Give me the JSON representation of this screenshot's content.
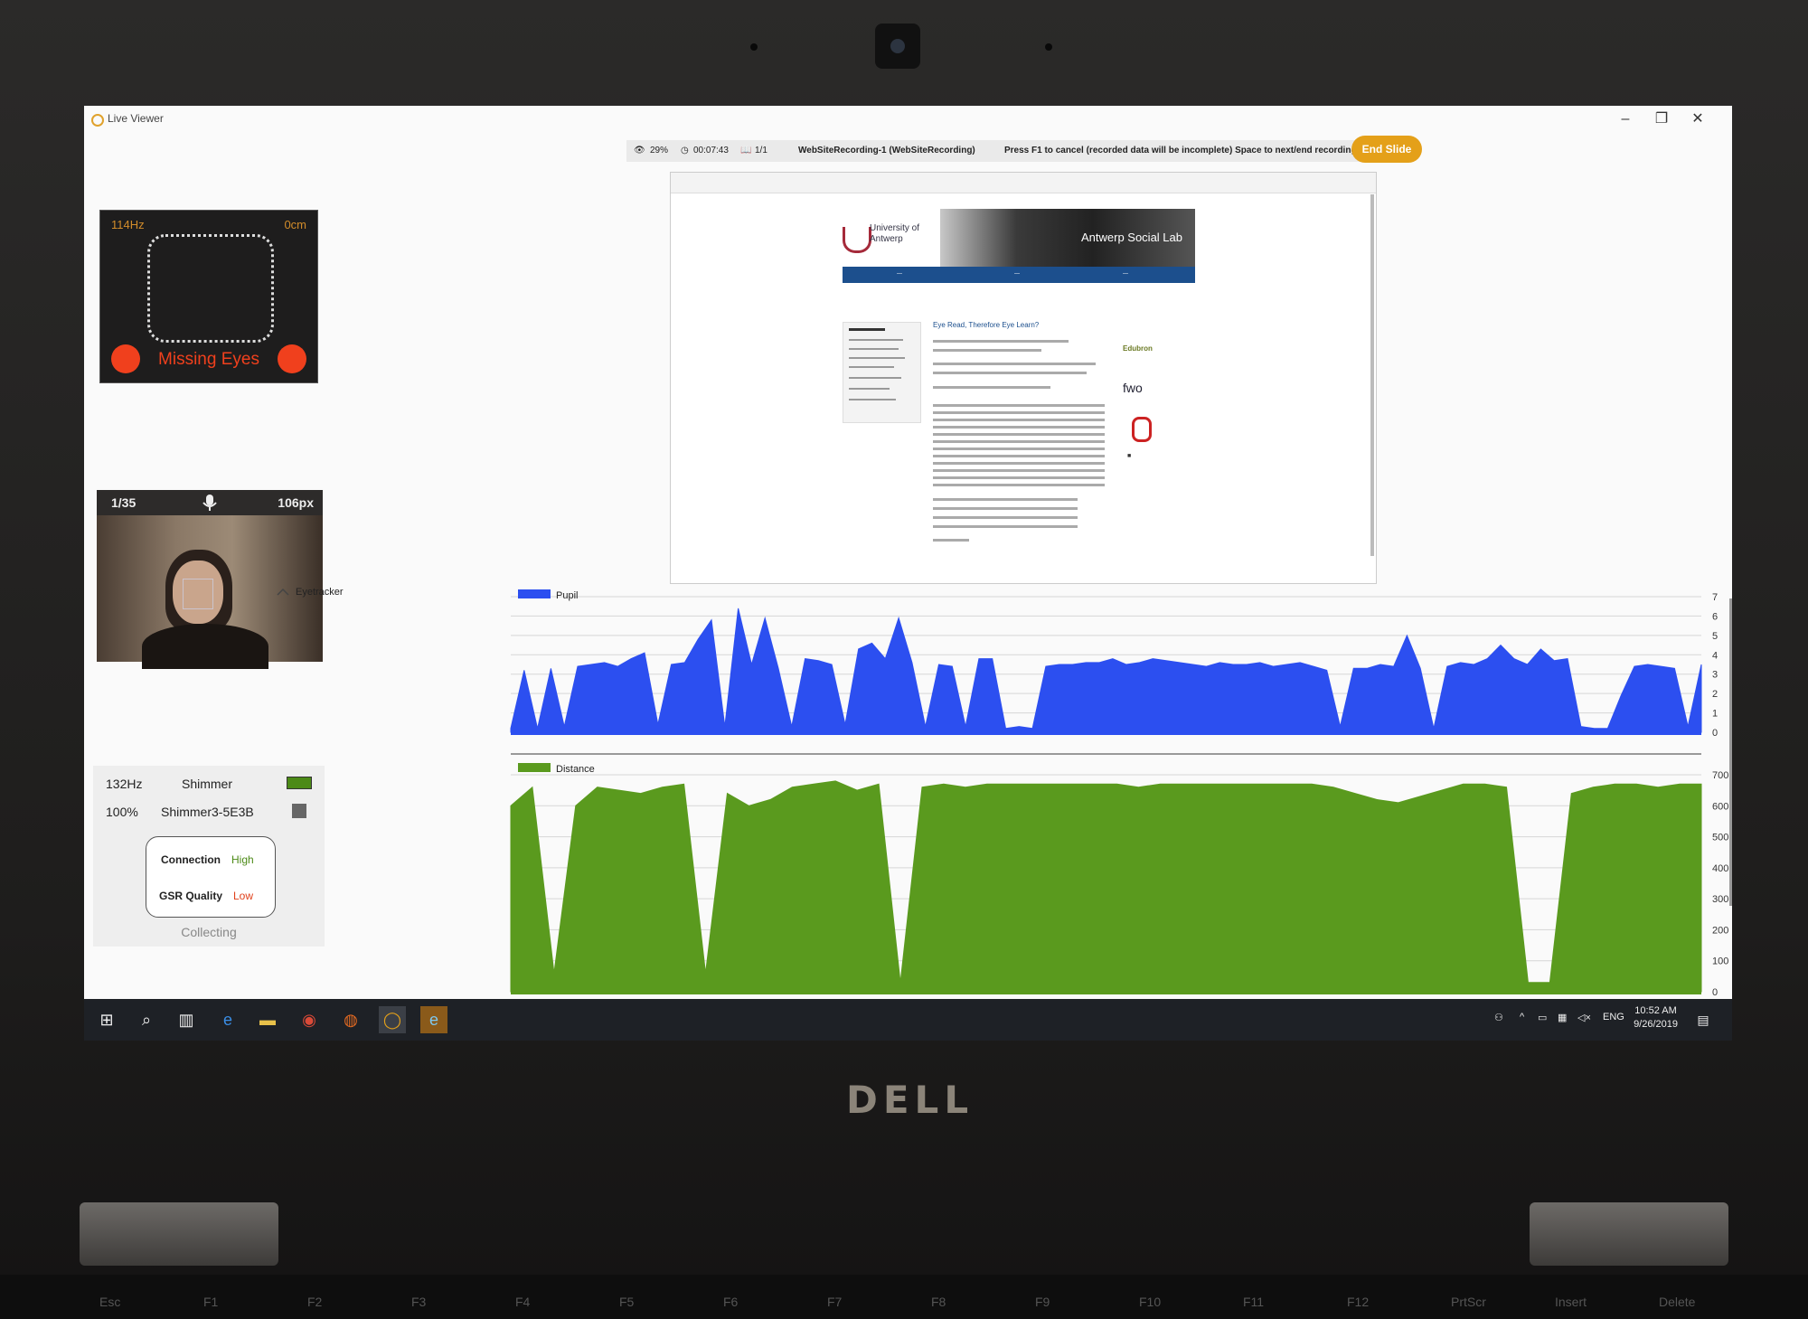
{
  "window": {
    "title": "Live Viewer"
  },
  "status": {
    "eye_percent": "29%",
    "timer": "00:07:43",
    "slide_count": "1/1",
    "recording": "WebSiteRecording-1 (WebSiteRecording)",
    "hint": "Press  F1 to cancel (recorded data will be incomplete)    Space to next/end recording",
    "end_button": "End Slide"
  },
  "eye_tracker": {
    "hz": "114Hz",
    "distance": "0cm",
    "message": "Missing Eyes"
  },
  "camera": {
    "count": "1/35",
    "px": "106px"
  },
  "shimmer": {
    "hz": "132Hz",
    "name": "Shimmer",
    "battery": "100%",
    "device": "Shimmer3-5E3B",
    "connection_label": "Connection",
    "connection_value": "High",
    "gsr_label": "GSR Quality",
    "gsr_value": "Low",
    "state": "Collecting"
  },
  "stimulus": {
    "university": "University of Antwerp",
    "banner": "Antwerp Social Lab",
    "page_title": "Eye Read, Therefore Eye Learn?",
    "logo_edu": "Edubron",
    "logo_fwo": "fwo"
  },
  "sensor_group": "Eyetracker",
  "chart_data": [
    {
      "type": "area",
      "series": [
        {
          "name": "Pupil",
          "color": "#2c4ff0"
        }
      ],
      "ylim": [
        0,
        7
      ],
      "yticks": [
        "0",
        "1",
        "2",
        "3",
        "4",
        "5",
        "6",
        "7"
      ],
      "values": [
        0.2,
        3.2,
        0.2,
        3.3,
        0.3,
        3.4,
        3.5,
        3.6,
        3.4,
        3.8,
        4.1,
        0.4,
        3.5,
        3.6,
        4.8,
        5.8,
        0.3,
        6.4,
        3.5,
        5.9,
        3.3,
        0.3,
        3.8,
        3.7,
        3.5,
        0.4,
        4.3,
        4.6,
        3.8,
        5.9,
        3.6,
        0.3,
        3.5,
        3.4,
        0.3,
        3.8,
        3.8,
        0.2,
        0.3,
        0.2,
        3.4,
        3.5,
        3.5,
        3.6,
        3.6,
        3.8,
        3.5,
        3.6,
        3.8,
        3.7,
        3.6,
        3.5,
        3.4,
        3.6,
        3.5,
        3.5,
        3.6,
        3.4,
        3.5,
        3.6,
        3.4,
        3.2,
        0.3,
        3.3,
        3.3,
        3.5,
        3.4,
        5.0,
        3.3,
        0.2,
        3.4,
        3.6,
        3.5,
        3.8,
        4.5,
        3.8,
        3.5,
        4.3,
        3.7,
        3.8,
        0.3,
        0.2,
        0.2,
        1.9,
        3.4,
        3.5,
        3.4,
        3.3,
        0.3,
        3.5
      ],
      "series_name_printed": "Pupil"
    },
    {
      "type": "area",
      "series": [
        {
          "name": "Distance",
          "color": "#5a9a1e"
        }
      ],
      "ylim": [
        0,
        700
      ],
      "yticks": [
        "0",
        "100",
        "200",
        "300",
        "400",
        "500",
        "600",
        "700"
      ],
      "values": [
        600,
        660,
        60,
        600,
        660,
        650,
        640,
        660,
        670,
        60,
        640,
        600,
        620,
        660,
        670,
        680,
        650,
        670,
        30,
        660,
        670,
        660,
        670,
        670,
        670,
        670,
        670,
        670,
        670,
        660,
        670,
        670,
        670,
        670,
        670,
        670,
        670,
        670,
        660,
        640,
        620,
        610,
        630,
        650,
        670,
        670,
        660,
        30,
        30,
        640,
        660,
        670,
        670,
        660,
        670,
        670
      ],
      "series_name_printed": "Distance"
    }
  ],
  "taskbar": {
    "lang": "ENG",
    "time": "10:52 AM",
    "date": "9/26/2019"
  },
  "hardware": {
    "brand": "DELL",
    "fkeys": [
      "Esc",
      "F1",
      "F2",
      "F3",
      "F4",
      "F5",
      "F6",
      "F7",
      "F8",
      "F9",
      "F10",
      "F11",
      "F12",
      "PrtScr",
      "Insert",
      "Delete"
    ]
  },
  "colors": {
    "accent": "#e4a019",
    "pupil": "#2c4ff0",
    "distance": "#5a9a1e",
    "alert": "#f0401d"
  }
}
